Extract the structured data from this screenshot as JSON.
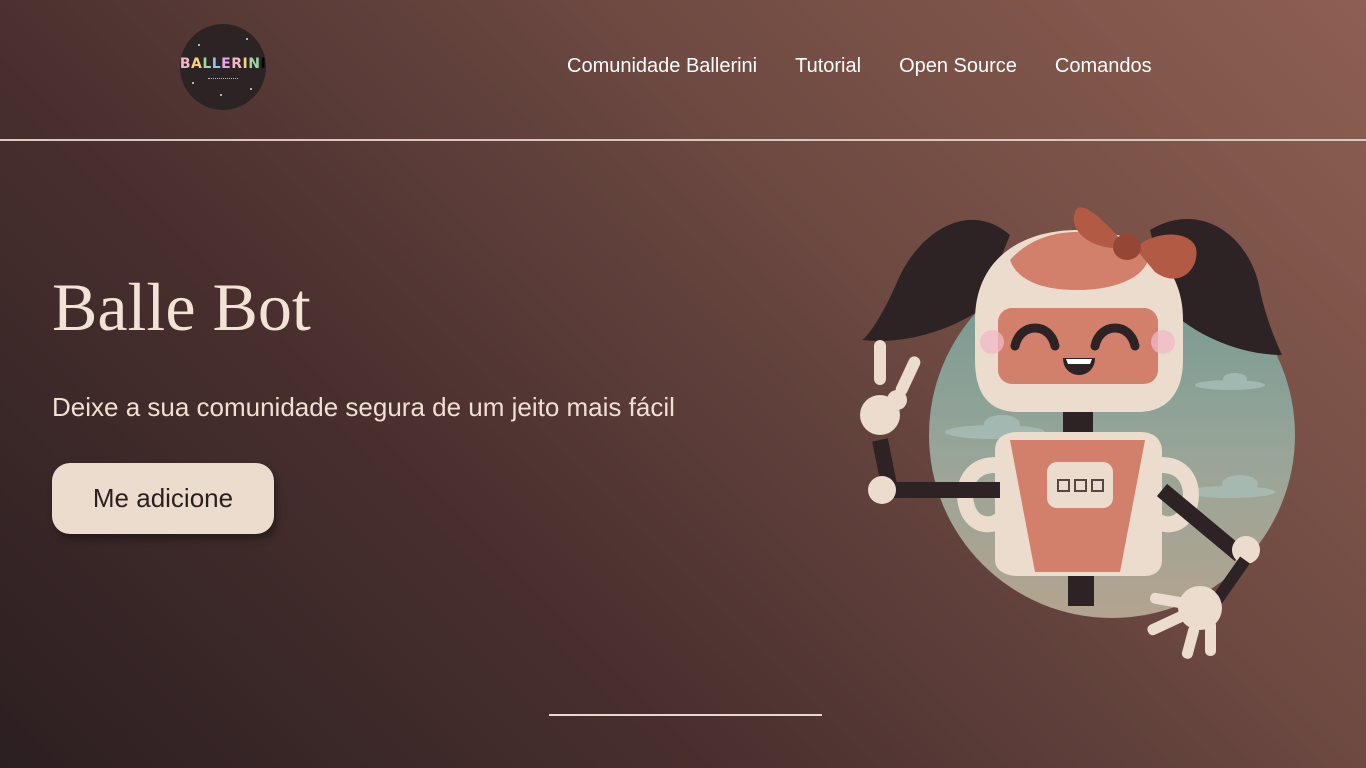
{
  "logo": {
    "text": "BALLERINI"
  },
  "nav": {
    "items": [
      {
        "label": "Comunidade Ballerini"
      },
      {
        "label": "Tutorial"
      },
      {
        "label": "Open Source"
      },
      {
        "label": "Comandos"
      }
    ]
  },
  "hero": {
    "title": "Balle Bot",
    "subtitle": "Deixe a sua comunidade segura de um jeito mais fácil",
    "button_label": "Me adicione"
  },
  "colors": {
    "background_dark": "#2c1f21",
    "background_light": "#8e5f52",
    "button_bg": "#ecdccd",
    "text_light": "#f3e3d6"
  },
  "icons": [
    "ballerini-logo",
    "robot-illustration"
  ]
}
